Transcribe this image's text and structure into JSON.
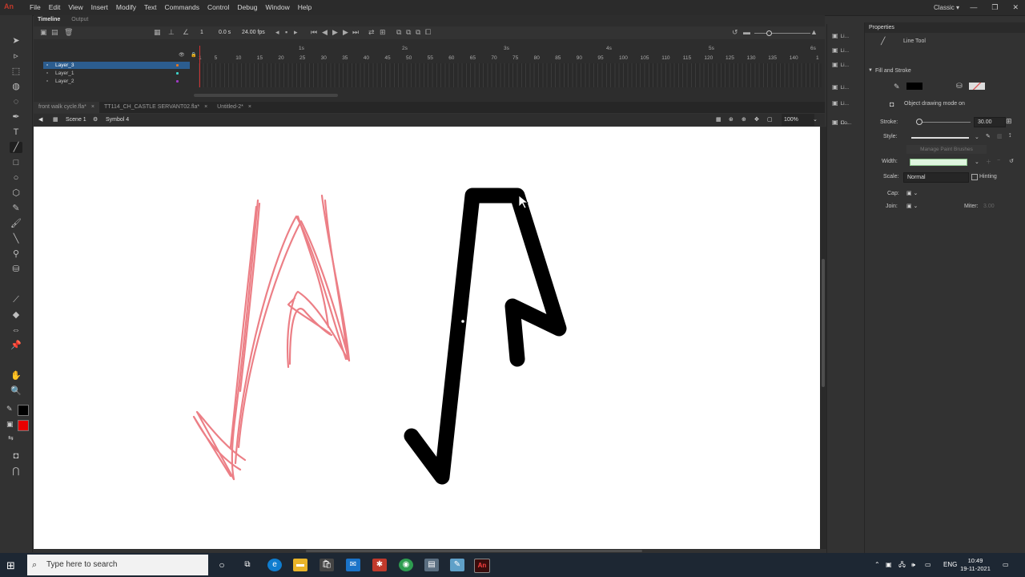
{
  "app": {
    "logo": "An",
    "menus": [
      "File",
      "Edit",
      "View",
      "Insert",
      "Modify",
      "Text",
      "Commands",
      "Control",
      "Debug",
      "Window",
      "Help"
    ],
    "workspace": "Classic ▾"
  },
  "timeline": {
    "tabs": [
      "Timeline",
      "Output"
    ],
    "current_frame": "1",
    "time": "0.0 s",
    "fps": "24.00 fps",
    "ruler_seconds": [
      "1s",
      "2s",
      "3s",
      "4s",
      "5s",
      "6s"
    ],
    "ruler_frames": [
      "1",
      "5",
      "10",
      "15",
      "20",
      "25",
      "30",
      "35",
      "40",
      "45",
      "50",
      "55",
      "60",
      "65",
      "70",
      "75",
      "80",
      "85",
      "90",
      "95",
      "100",
      "105",
      "110",
      "115",
      "120",
      "125",
      "130",
      "135",
      "140",
      "1"
    ],
    "layers": [
      {
        "name": "Layer_3",
        "color": "#e8771f",
        "selected": true
      },
      {
        "name": "Layer_1",
        "color": "#3ed3c8",
        "selected": false
      },
      {
        "name": "Layer_2",
        "color": "#a03ac6",
        "selected": false
      }
    ]
  },
  "doc_tabs": [
    "front walk cycle.fla*",
    "TT114_CH_CASTLE SERVANT02.fla*",
    "Untitled-2*"
  ],
  "edit_bar": {
    "scene": "Scene 1",
    "symbol": "Symbol 4",
    "zoom": "100%"
  },
  "mid_panel": [
    "Li...",
    "Li...",
    "Li...",
    "Li...",
    "Li...",
    "Li...",
    "Co..."
  ],
  "properties": {
    "title": "Properties",
    "tool_name": "Line Tool",
    "section": "Fill and Stroke",
    "object_drawing": "Object drawing mode on",
    "stroke_label": "Stroke:",
    "stroke_value": "30.00",
    "style_label": "Style:",
    "manage_brushes": "Manage Paint Brushes",
    "width_label": "Width:",
    "scale_label": "Scale:",
    "scale_value": "Normal",
    "hinting_label": "Hinting",
    "cap_label": "Cap:",
    "join_label": "Join:",
    "miter_label": "Miter:",
    "miter_value": "3.00",
    "stroke_color": "#000000",
    "fill_color": "#e84a4a"
  },
  "tools": {
    "stroke_color": "#000000",
    "fill_color": "#e80000"
  },
  "taskbar": {
    "search_placeholder": "Type here to search",
    "lang": "ENG",
    "time": "10:49",
    "date": "19-11-2021"
  }
}
